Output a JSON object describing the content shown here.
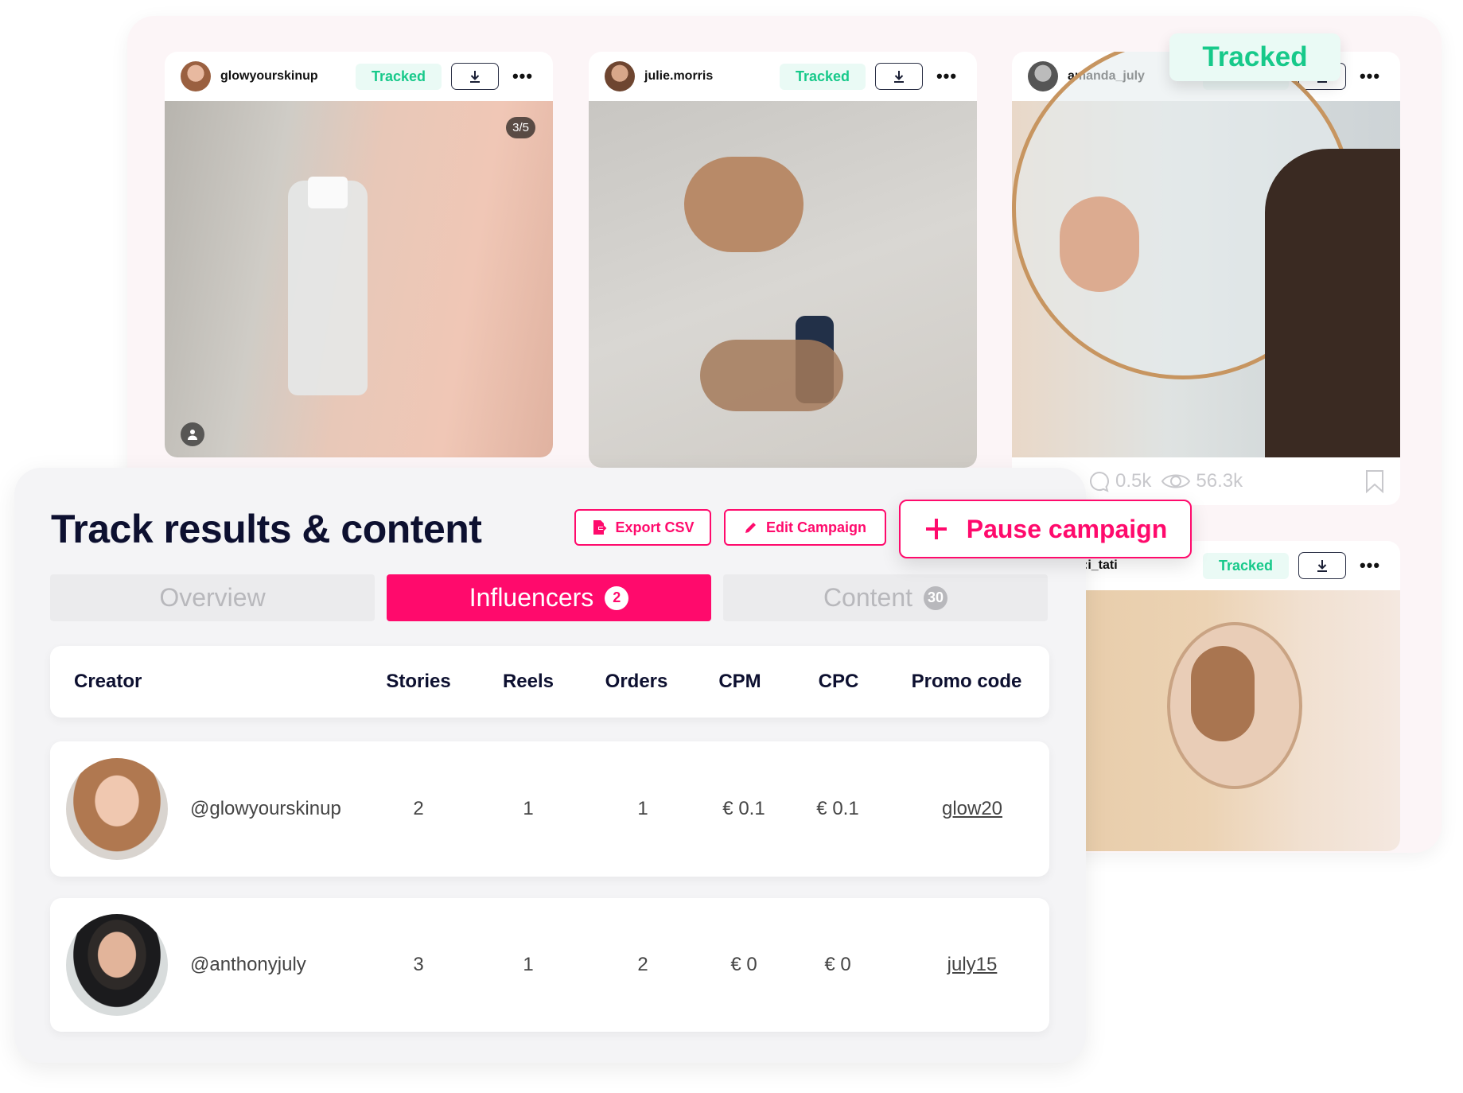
{
  "posts": [
    {
      "username": "glowyourskinup",
      "status": "Tracked",
      "image_counter": "3/5"
    },
    {
      "username": "julie.morris",
      "status": "Tracked"
    },
    {
      "username": "amanda_july",
      "status": "Tracked",
      "comments": "0.5k",
      "views": "56.3k"
    },
    {
      "username": ":i_tati",
      "status": "Tracked"
    }
  ],
  "floating_badge": "Tracked",
  "header": {
    "title": "Track results & content",
    "export_label": "Export CSV",
    "edit_label": "Edit Campaign",
    "pause_label": "Pause campaign"
  },
  "tabs": [
    {
      "label": "Overview",
      "active": false
    },
    {
      "label": "Influencers",
      "count": "2",
      "active": true
    },
    {
      "label": "Content",
      "count": "30",
      "active": false
    }
  ],
  "table": {
    "columns": [
      "Creator",
      "Stories",
      "Reels",
      "Orders",
      "CPM",
      "CPC",
      "Promo code"
    ],
    "rows": [
      {
        "creator": "@glowyourskinup",
        "stories": "2",
        "reels": "1",
        "orders": "1",
        "cpm": "€ 0.1",
        "cpc": "€ 0.1",
        "promo": "glow20"
      },
      {
        "creator": "@anthonyjuly",
        "stories": "3",
        "reels": "1",
        "orders": "2",
        "cpm": "€ 0",
        "cpc": "€ 0",
        "promo": "july15"
      }
    ]
  },
  "colors": {
    "accent": "#ff0a6c",
    "tracked": "#17c98a",
    "tracked_bg": "#eafaf5"
  }
}
